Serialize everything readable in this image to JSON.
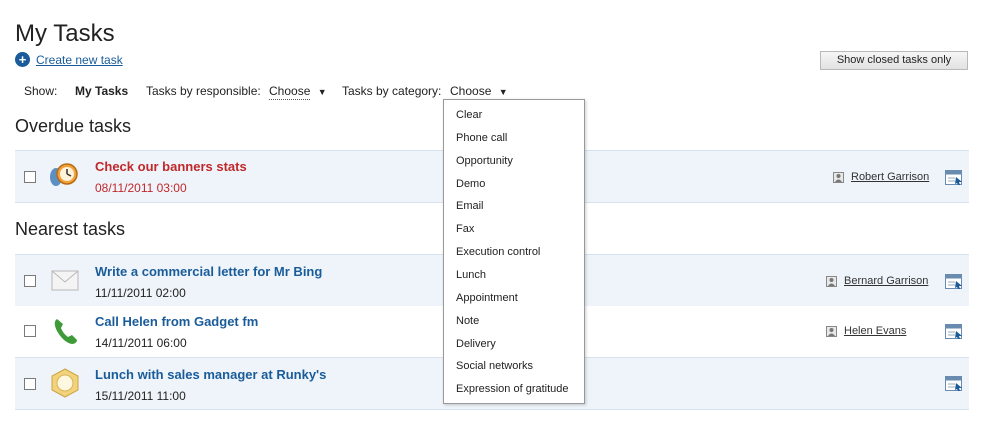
{
  "header": {
    "title": "My Tasks",
    "create_label": "Create new task",
    "closed_button": "Show closed tasks only"
  },
  "filters": {
    "show_label": "Show:",
    "my_tasks": "My Tasks",
    "responsible_label": "Tasks by responsible:",
    "responsible_value": "Choose",
    "category_label": "Tasks by category:",
    "category_value": "Choose",
    "arrow": "▼"
  },
  "sections": {
    "overdue": "Overdue tasks",
    "nearest": "Nearest tasks"
  },
  "overdue_tasks": [
    {
      "title": "Check our banners stats",
      "date": "08/11/2011 03:00",
      "responsible": "Robert Garrison",
      "icon": "execution-control-icon",
      "overdue": true
    }
  ],
  "nearest_tasks": [
    {
      "title": "Write a commercial letter for Mr Bing",
      "date": "11/11/2011 02:00",
      "responsible": "Bernard Garrison",
      "icon": "envelope-icon"
    },
    {
      "title": "Call Helen from Gadget fm",
      "date": "14/11/2011 06:00",
      "responsible": "Helen Evans",
      "icon": "phone-icon"
    },
    {
      "title": "Lunch with sales manager at Runky's",
      "date": "15/11/2011 11:00",
      "responsible": "",
      "icon": "lunch-plate-icon"
    }
  ],
  "category_menu": [
    "Clear",
    "Phone call",
    "Opportunity",
    "Demo",
    "Email",
    "Fax",
    "Execution control",
    "Lunch",
    "Appointment",
    "Note",
    "Delivery",
    "Social networks",
    "Expression of gratitude"
  ],
  "colors": {
    "link_blue": "#1a5c9a",
    "overdue_red": "#c0282a",
    "row_blue": "#eef4fa",
    "row_border": "#d6e2ee"
  }
}
